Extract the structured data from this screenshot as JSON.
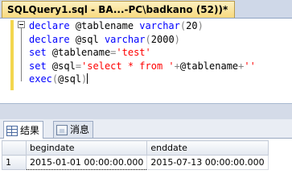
{
  "tab": {
    "title": "SQLQuery1.sql - BA...-PC\\badkano (52))*"
  },
  "editor": {
    "lines": [
      {
        "kw1": "declare",
        "var": "@tablename",
        "kw2": "varchar",
        "p1": "(",
        "num": "20",
        "p2": ")"
      },
      {
        "kw1": "declare",
        "var": "@sql",
        "kw2": "varchar",
        "p1": "(",
        "num": "2000",
        "p2": ")"
      },
      {
        "kw1": "set",
        "var": "@tablename",
        "eq": "=",
        "str": "'test'"
      },
      {
        "kw1": "set",
        "var": "@sql",
        "eq": "=",
        "str1": "'select * from '",
        "op1": "+",
        "var2": "@tablename",
        "op2": "+",
        "str2": "''"
      },
      {
        "kw1": "exec",
        "p1": "(",
        "var": "@sql",
        "p2": ")"
      }
    ]
  },
  "results_tabs": [
    {
      "label": "结果",
      "icon": "grid-icon"
    },
    {
      "label": "消息",
      "icon": "message-icon"
    }
  ],
  "grid": {
    "columns": [
      "begindate",
      "enddate"
    ],
    "rows": [
      {
        "num": "1",
        "cells": [
          "2015-01-01 00:00:00.000",
          "2015-07-13 00:00:00.000"
        ]
      }
    ]
  }
}
